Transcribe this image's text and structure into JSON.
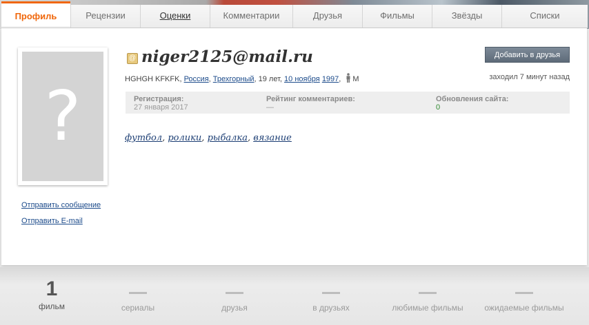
{
  "tabs": [
    {
      "label": "Профиль"
    },
    {
      "label": "Рецензии"
    },
    {
      "label": "Оценки"
    },
    {
      "label": "Комментарии"
    },
    {
      "label": "Друзья"
    },
    {
      "label": "Фильмы"
    },
    {
      "label": "Звёзды"
    },
    {
      "label": "Списки"
    }
  ],
  "profile": {
    "avatar_placeholder": "?",
    "username": "niger2125@mail.ru",
    "add_friend_label": "Добавить в друзья",
    "name": "HGHGH KFKFK",
    "country": "Россия",
    "city": "Трехгорный",
    "age": "19 лет",
    "birth_day": "10 ноября",
    "birth_year": "1997",
    "gender": "М",
    "last_seen": "заходил 7 минут назад",
    "send_message": "Отправить сообщение",
    "send_email": "Отправить E-mail"
  },
  "stats": {
    "registration_label": "Регистрация:",
    "registration_value": "27 января 2017",
    "rating_label": "Рейтинг комментариев:",
    "rating_value": "—",
    "updates_label": "Обновления сайта:",
    "updates_value": "0"
  },
  "interests": [
    "футбол",
    "ролики",
    "рыбалка",
    "вязание"
  ],
  "bottom": [
    {
      "value": "1",
      "label": "фильм"
    },
    {
      "value": "",
      "label": "сериалы"
    },
    {
      "value": "",
      "label": "друзья"
    },
    {
      "value": "",
      "label": "в друзьях"
    },
    {
      "value": "",
      "label": "любимые фильмы"
    },
    {
      "value": "",
      "label": "ожидаемые фильмы"
    }
  ],
  "colors": {
    "accent": "#f0660a",
    "link": "#1b4a8a",
    "button": "#6b7886"
  }
}
